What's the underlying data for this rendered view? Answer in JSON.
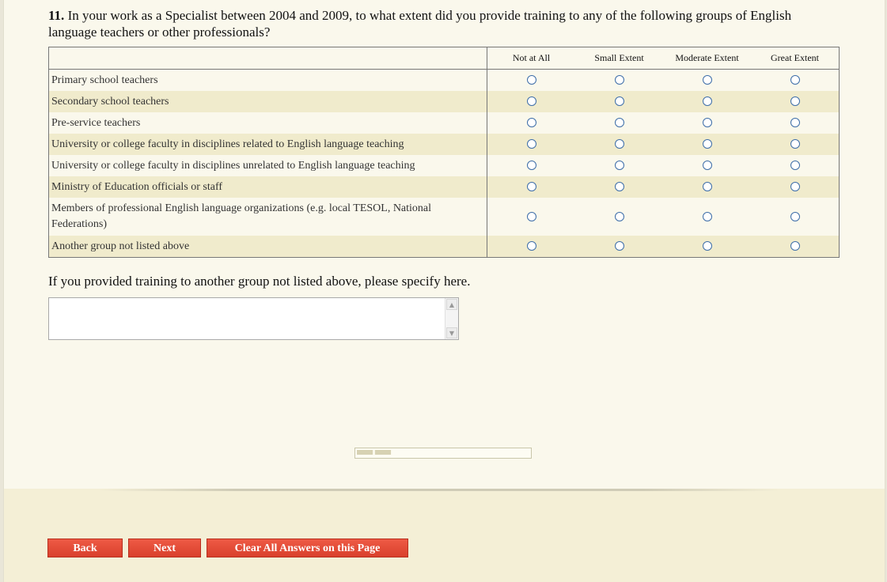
{
  "question": {
    "number": "11.",
    "text": " In your work as a Specialist between 2004 and 2009, to what extent did you provide training to any of the following groups of English language teachers or other professionals?"
  },
  "grid": {
    "columns": [
      "Not at All",
      "Small Extent",
      "Moderate Extent",
      "Great Extent"
    ],
    "rows": [
      "Primary school teachers",
      "Secondary school teachers",
      "Pre-service teachers",
      "University or college faculty in disciplines related to English language teaching",
      "University or college faculty in disciplines unrelated to English language teaching",
      "Ministry of Education officials or staff",
      "Members of professional English language organizations (e.g. local TESOL, National Federations)",
      "Another group not listed above"
    ]
  },
  "specify": {
    "label": "If you provided training to another group not listed above, please specify here.",
    "value": ""
  },
  "progress": {
    "fraction": 0.2
  },
  "buttons": {
    "back": "Back",
    "next": "Next",
    "clear": "Clear All Answers on this Page"
  },
  "colors": {
    "button": "#e04a35",
    "row_shade": "#f0ebcc",
    "background": "#faf8ec",
    "footer": "#f4efd6"
  }
}
